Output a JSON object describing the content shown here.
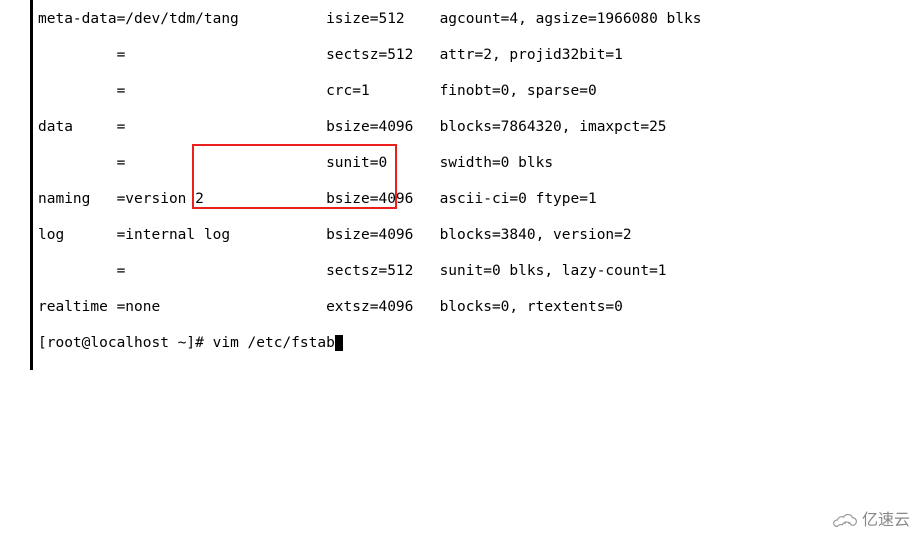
{
  "terminal": {
    "lines": [
      "meta-data=/dev/tdm/tang          isize=512    agcount=4, agsize=1966080 blks",
      "         =                       sectsz=512   attr=2, projid32bit=1",
      "         =                       crc=1        finobt=0, sparse=0",
      "data     =                       bsize=4096   blocks=7864320, imaxpct=25",
      "         =                       sunit=0      swidth=0 blks",
      "naming   =version 2              bsize=4096   ascii-ci=0 ftype=1",
      "log      =internal log           bsize=4096   blocks=3840, version=2",
      "         =                       sectsz=512   sunit=0 blks, lazy-count=1",
      "realtime =none                   extsz=4096   blocks=0, rtextents=0"
    ],
    "prompt": "[root@localhost ~]# ",
    "command": "vim /etc/fstab"
  },
  "watermark": {
    "text": "亿速云"
  }
}
